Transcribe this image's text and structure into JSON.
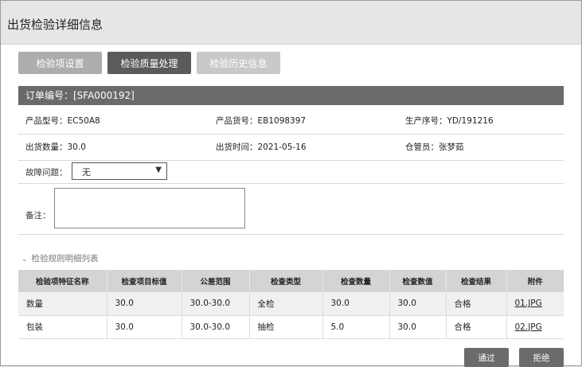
{
  "window": {
    "title": "出货检验详细信息"
  },
  "tabs": [
    {
      "label": "检验项设置"
    },
    {
      "label": "检验质量处理"
    },
    {
      "label": "检验历史信息"
    }
  ],
  "order": {
    "label": "订单编号：[SFA000192]"
  },
  "info": {
    "product_model": "产品型号：EC50A8",
    "product_code": "产品货号：EB1098397",
    "production_no": "生产序号：YD/191216",
    "ship_qty": "出货数量：30.0",
    "ship_time": "出货时间：2021-05-16",
    "keeper": "仓管员：张梦茹"
  },
  "fault": {
    "label": "故障问题：",
    "selected": "无"
  },
  "remarks": {
    "label": "备注：",
    "value": ""
  },
  "rules": {
    "title": "检验规则明细列表",
    "headers": [
      "检验项特征名称",
      "检查项目标值",
      "公差范围",
      "检查类型",
      "检查数量",
      "检查数值",
      "检查结果",
      "附件"
    ],
    "rows": [
      [
        "数量",
        "30.0",
        "30.0-30.0",
        "全检",
        "30.0",
        "30.0",
        "合格",
        "01.JPG"
      ],
      [
        "包装",
        "30.0",
        "30.0-30.0",
        "抽检",
        "5.0",
        "30.0",
        "合格",
        "02.JPG"
      ]
    ]
  },
  "actions": {
    "pass": "通过",
    "reject": "拒绝"
  }
}
